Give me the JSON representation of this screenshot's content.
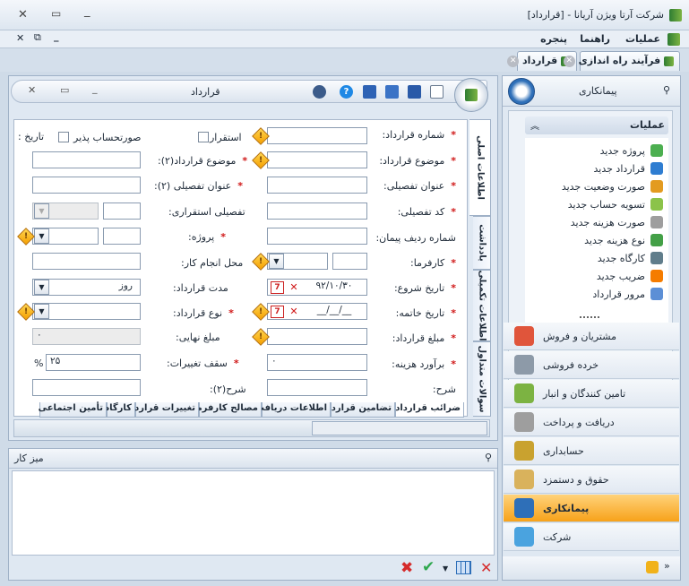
{
  "window": {
    "title": "شرکت آرتا ویژن آریانا - [قرارداد]"
  },
  "menu": {
    "items": [
      "عملیات",
      "راهنما",
      "پنجره"
    ]
  },
  "doc_tabs": [
    {
      "label": "قرارداد"
    },
    {
      "label": "فرآیند راه اندازی"
    }
  ],
  "form": {
    "title": "قرارداد",
    "fields": {
      "contract_no": "شماره قرارداد:",
      "contract_subject": "موضوع قرارداد:",
      "detail_title": "عنوان تفصیلی:",
      "detail_code": "کد تفصیلی:",
      "contract_row_no": "شماره ردیف پیمان:",
      "employer": "کارفرما:",
      "start_date": "تاریخ شروع:",
      "start_date_value": "۹۲/۱۰/۳۰",
      "end_date": "تاریخ خاتمه:",
      "end_date_value": "__/__/__",
      "contract_amount": "مبلغ قرارداد:",
      "cost_estimate": "برآورد هزینه:",
      "cost_estimate_value": "۰",
      "description": "شرح:",
      "settlement": "استقرار",
      "billable": "صورتحساب پذیر",
      "date": "تاریخ :",
      "subject2": "موضوع قرارداد(۲):",
      "detail_title2": "عنوان تفصیلی (۲):",
      "settlement_detail": "تفصیلی استقراری:",
      "project": "پروژه:",
      "work_place": "محل انجام کار:",
      "duration": "مدت قرارداد:",
      "duration_unit": "روز",
      "contract_type": "نوع قرارداد:",
      "final_amount": "مبلغ نهایی:",
      "final_amount_value": "۰",
      "change_cap": "سقف تغییرات:",
      "change_cap_value": "۲۵",
      "percent_sign": "%",
      "description2": "شرح(۲):"
    },
    "bottom_tabs": [
      "ضرائب قرارداد",
      "تضامین قرارداد",
      "اطلاعات دریافت",
      "مصالح کارفرما",
      "تغییرات قرارداد",
      "کارگاه",
      "تأمین اجتماعی"
    ],
    "side_tabs": [
      "اطلاعات اصلی",
      "یادداشت",
      "اطلاعات تکمیلی",
      "سوالات متداول"
    ]
  },
  "desk": {
    "title": "میز کار"
  },
  "right_panel": {
    "title": "پیمانکاری",
    "ops_title": "عملیات",
    "ops": [
      {
        "label": "پروژه جدید",
        "icon": "project-icon",
        "color": "#4caf50"
      },
      {
        "label": "قرارداد جدید",
        "icon": "contract-icon",
        "color": "#2e7dd1"
      },
      {
        "label": "صورت وضعیت جدید",
        "icon": "statement-icon",
        "color": "#e39b20"
      },
      {
        "label": "تسویه حساب جدید",
        "icon": "settlement-icon",
        "color": "#8bc34a"
      },
      {
        "label": "صورت هزینه جدید",
        "icon": "cost-statement-icon",
        "color": "#9e9e9e"
      },
      {
        "label": "نوع هزینه جدید",
        "icon": "cost-type-icon",
        "color": "#43a047"
      },
      {
        "label": "کارگاه جدید",
        "icon": "workshop-icon",
        "color": "#607d8b"
      },
      {
        "label": "ضریب جدید",
        "icon": "percent-icon",
        "color": "#f57c00"
      },
      {
        "label": "مرور قرارداد",
        "icon": "review-icon",
        "color": "#5c8fd6"
      }
    ],
    "nav": [
      {
        "label": "مشتریان و فروش",
        "color": "#e0553b"
      },
      {
        "label": "خرده فروشی",
        "color": "#8d9aa8"
      },
      {
        "label": "تامین کنندگان و انبار",
        "color": "#7cb342"
      },
      {
        "label": "دریافت و پرداخت",
        "color": "#9e9e9e"
      },
      {
        "label": "حسابداری",
        "color": "#c9a22f"
      },
      {
        "label": "حقوق و دستمزد",
        "color": "#d9b25c"
      },
      {
        "label": "پیمانکاری",
        "color": "#2e6fb8",
        "active": true
      },
      {
        "label": "شرکت",
        "color": "#4aa3df"
      }
    ]
  }
}
